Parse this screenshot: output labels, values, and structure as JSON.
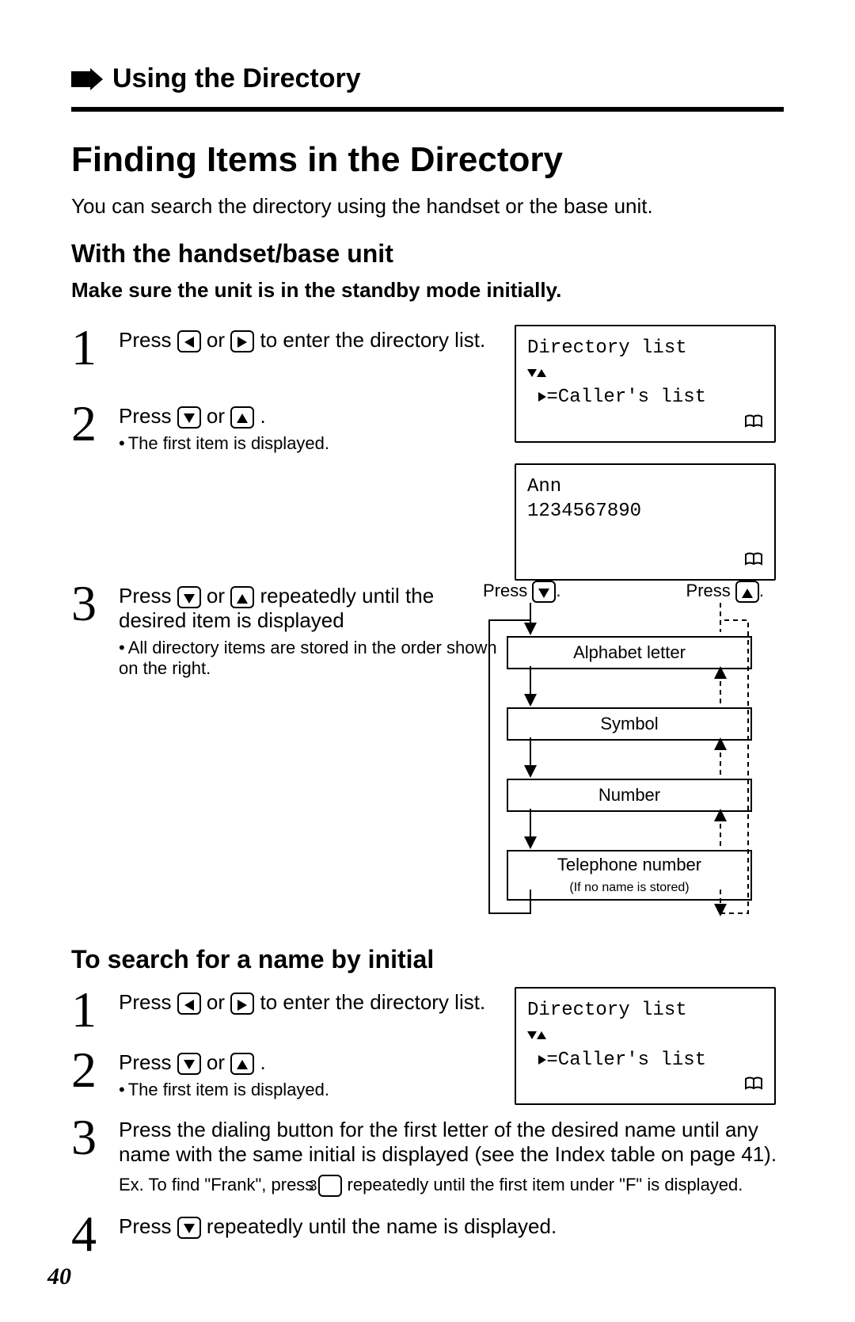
{
  "chapter_title": "Using the Directory",
  "page_title": "Finding Items in the Directory",
  "intro": "You can search the directory using the handset or the base unit.",
  "section1": {
    "heading": "With the handset/base unit",
    "note": "Make sure the unit is in the standby mode initially.",
    "steps": [
      {
        "text_before": "Press ",
        "text_mid": " or ",
        "text_after": " to enter the directory list.",
        "key1": "left",
        "key2": "right"
      },
      {
        "text_before": "Press ",
        "text_mid": " or ",
        "text_after": ".",
        "key1": "down",
        "key2": "up",
        "subnote": "The first item is displayed."
      },
      {
        "text_before": "Press ",
        "text_mid": " or ",
        "text_after": " repeatedly until the desired item is displayed",
        "key1": "down",
        "key2": "up",
        "subnote": "All directory items are stored in the order shown on the right."
      }
    ],
    "lcd1": {
      "line1": "Directory list",
      "callers_label": "=Caller's list"
    },
    "lcd2": {
      "line1": "Ann",
      "line2": "1234567890"
    },
    "diagram": {
      "press_down": "Press ",
      "press_down_suffix": ".",
      "press_up": "Press ",
      "press_up_suffix": ".",
      "box1": "Alphabet letter",
      "box2": "Symbol",
      "box3": "Number",
      "box4": "Telephone number",
      "box4_sub": "(If no name is stored)"
    }
  },
  "section2": {
    "heading": "To search for a name by initial",
    "steps": [
      {
        "text_before": "Press ",
        "text_mid": " or ",
        "text_after": " to enter the directory list.",
        "key1": "left",
        "key2": "right"
      },
      {
        "text_before": "Press ",
        "text_mid": " or ",
        "text_after": ".",
        "key1": "down",
        "key2": "up",
        "subnote": "The first item is displayed."
      },
      {
        "full_text": "Press the dialing button for the first letter of the desired name until any name with the same initial is displayed (see the Index table on page 41).",
        "ex_prefix": "Ex.  To find \"Frank\", press ",
        "ex_key": "3",
        "ex_suffix": " repeatedly until the first item under \"F\" is displayed."
      },
      {
        "text_before": "Press ",
        "text_after": " repeatedly until the name is displayed.",
        "key1": "down"
      }
    ],
    "lcd": {
      "line1": "Directory list",
      "callers_label": "=Caller's list"
    }
  },
  "page_number": "40"
}
